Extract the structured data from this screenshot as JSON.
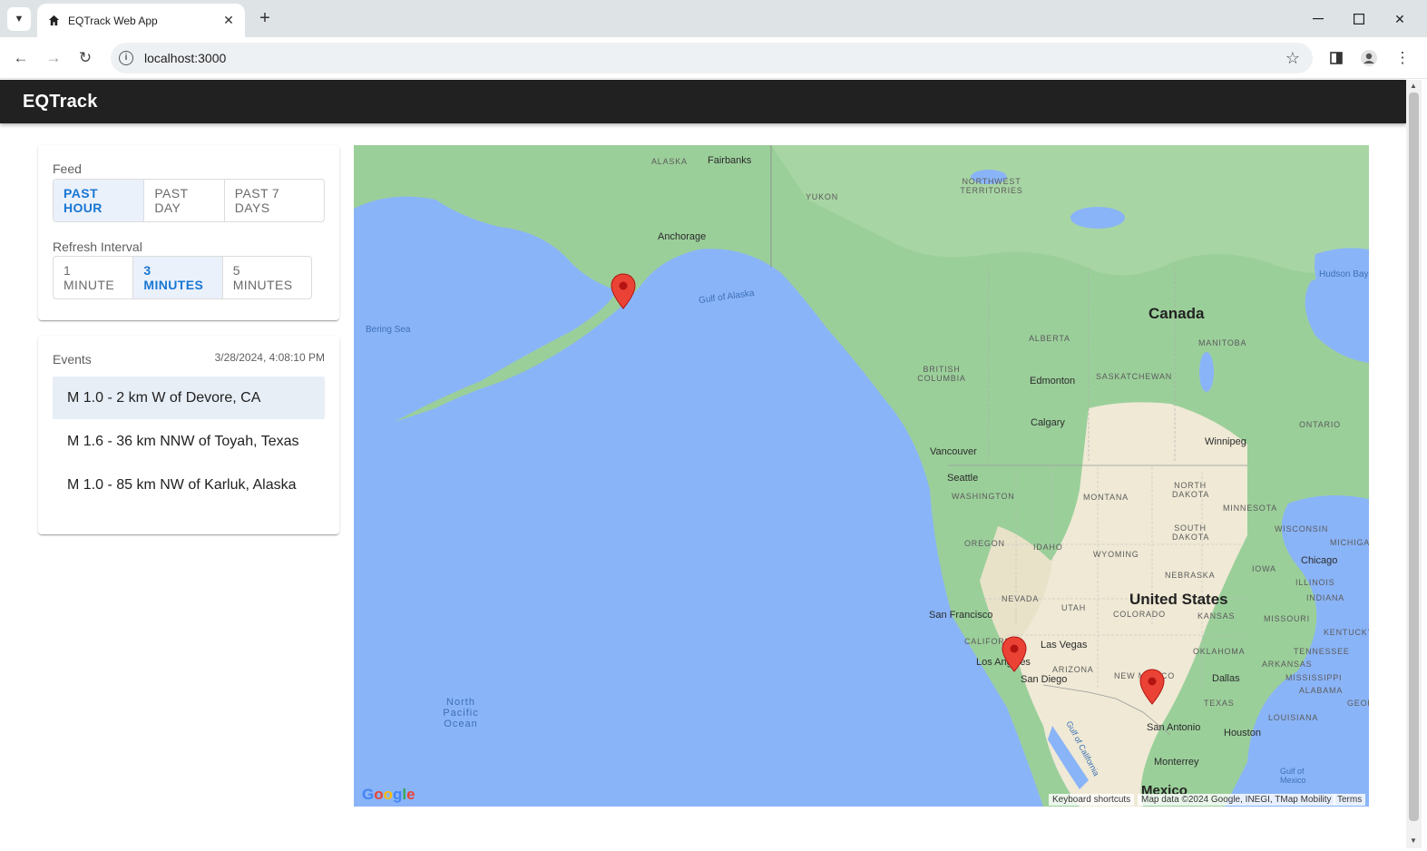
{
  "browser": {
    "tab_title": "EQTrack Web App",
    "url": "localhost:3000"
  },
  "app": {
    "brand": "EQTrack"
  },
  "feed": {
    "label": "Feed",
    "options": [
      "PAST HOUR",
      "PAST DAY",
      "PAST 7 DAYS"
    ],
    "selected": "PAST HOUR"
  },
  "refresh": {
    "label": "Refresh Interval",
    "options": [
      "1 MINUTE",
      "3 MINUTES",
      "5 MINUTES"
    ],
    "selected": "3 MINUTES"
  },
  "events": {
    "label": "Events",
    "timestamp": "3/28/2024, 4:08:10 PM",
    "items": [
      "M 1.0 - 2 km W of Devore, CA",
      "M 1.6 - 36 km NNW of Toyah, Texas",
      "M 1.0 - 85 km NW of Karluk, Alaska"
    ],
    "selected_index": 0
  },
  "map": {
    "countries": [
      "Canada",
      "United States",
      "Mexico"
    ],
    "regions": [
      "ALASKA",
      "YUKON",
      "NORTHWEST TERRITORIES",
      "BRITISH COLUMBIA",
      "ALBERTA",
      "SASKATCHEWAN",
      "MANITOBA",
      "ONTARIO",
      "WASHINGTON",
      "OREGON",
      "IDAHO",
      "MONTANA",
      "WYOMING",
      "NORTH DAKOTA",
      "SOUTH DAKOTA",
      "MINNESOTA",
      "WISCONSIN",
      "MICHIGAN",
      "NEBRASKA",
      "IOWA",
      "ILLINOIS",
      "INDIANA",
      "NEVADA",
      "UTAH",
      "COLORADO",
      "KANSAS",
      "MISSOURI",
      "KENTUCKY",
      "CALIFORNIA",
      "ARIZONA",
      "NEW MEXICO",
      "OKLAHOMA",
      "TENNESSEE",
      "ARKANSAS",
      "MISSISSIPPI",
      "ALABAMA",
      "TEXAS",
      "LOUISIANA",
      "GEORGIA"
    ],
    "cities": [
      "Fairbanks",
      "Anchorage",
      "Edmonton",
      "Calgary",
      "Vancouver",
      "Seattle",
      "Winnipeg",
      "Chicago",
      "San Francisco",
      "Los Angeles",
      "Las Vegas",
      "San Diego",
      "Dallas",
      "San Antonio",
      "Houston",
      "Monterrey"
    ],
    "waters": [
      "Bering Sea",
      "Gulf of Alaska",
      "Hudson Bay",
      "North Pacific Ocean",
      "Gulf of California",
      "Gulf of Mexico"
    ],
    "logo": "Google",
    "attribution": {
      "shortcuts": "Keyboard shortcuts",
      "data": "Map data ©2024 Google, INEGI, TMap Mobility",
      "terms": "Terms"
    },
    "marker_count": 3
  }
}
